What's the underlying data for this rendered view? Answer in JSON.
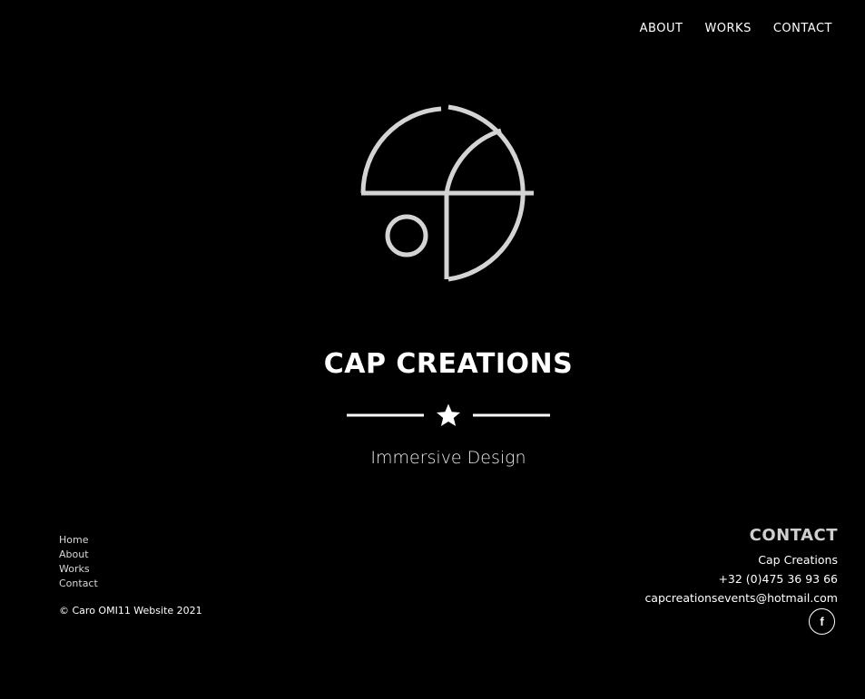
{
  "nav": {
    "items": [
      {
        "label": "ABOUT"
      },
      {
        "label": "WORKS"
      },
      {
        "label": "CONTACT"
      }
    ]
  },
  "hero": {
    "title": "CAP CREATIONS",
    "tagline": "Immersive Design",
    "divider_icon": "star-icon",
    "logo_color": "#d4d4d4"
  },
  "footer": {
    "links": [
      {
        "label": "Home"
      },
      {
        "label": "About"
      },
      {
        "label": "Works"
      },
      {
        "label": "Contact"
      }
    ],
    "copyright": "© Caro OMI11 Website 2021",
    "contact": {
      "heading": "CONTACT",
      "name": "Cap Creations",
      "phone": "+32 (0)475 36 93 66",
      "email": "capcreationsevents@hotmail.com"
    },
    "social": {
      "icon": "facebook-icon",
      "glyph": "f"
    }
  }
}
